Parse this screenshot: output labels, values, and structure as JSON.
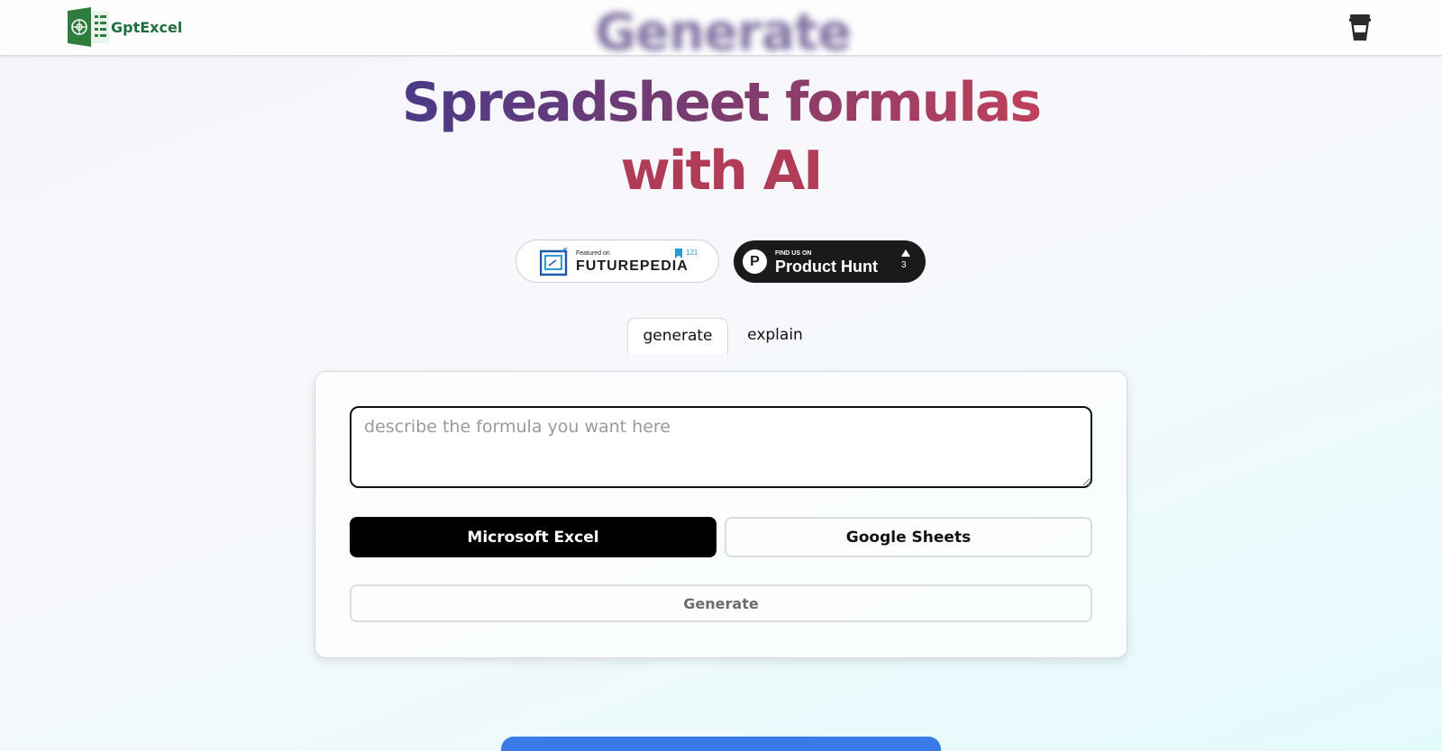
{
  "header": {
    "logo_text": "GptExcel",
    "ghost_heading": "Generate",
    "coffee_icon": "coffee-cup-icon"
  },
  "hero": {
    "line1": "Spreadsheet formulas",
    "line2": "with AI"
  },
  "badges": {
    "futurepedia": {
      "small": "Featured on",
      "big": "FUTUREPEDIA",
      "count": "121"
    },
    "producthunt": {
      "small": "FIND US ON",
      "big": "Product Hunt",
      "count": "3",
      "letter": "P"
    }
  },
  "tabs": [
    {
      "label": "generate",
      "active": true
    },
    {
      "label": "explain",
      "active": false
    }
  ],
  "form": {
    "placeholder": "describe the formula you want here",
    "value": "",
    "excel_label": "Microsoft Excel",
    "sheets_label": "Google Sheets",
    "generate_label": "Generate"
  },
  "colors": {
    "accent_green": "#1e6f3d",
    "hero_purple": "#4b3a86",
    "hero_red": "#b03c58",
    "banner_blue": "#3b7be8"
  }
}
